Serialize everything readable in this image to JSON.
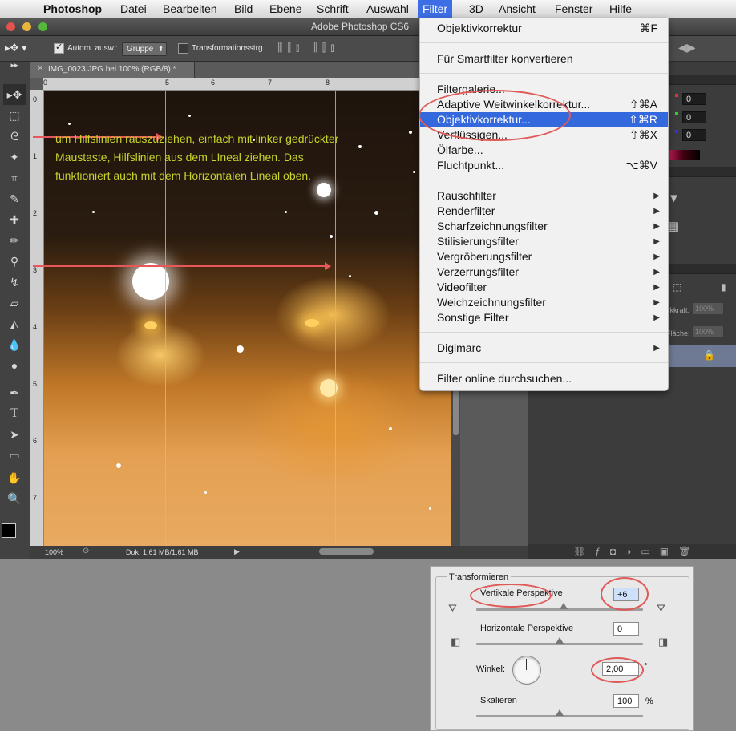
{
  "menubar": {
    "apple": "",
    "items": [
      "Photoshop",
      "Datei",
      "Bearbeiten",
      "Bild",
      "Ebene",
      "Schrift",
      "Auswahl",
      "Filter",
      "3D",
      "Ansicht",
      "Fenster",
      "Hilfe"
    ]
  },
  "window": {
    "title": "Adobe Photoshop CS6"
  },
  "options": {
    "auto_select_label": "Autom. ausw.:",
    "auto_select_value": "Gruppe",
    "transform_controls_label": "Transformationsstrg."
  },
  "document": {
    "tab_title": "IMG_0023.JPG bei 100% (RGB/8) *",
    "ruler_h": [
      "0",
      "5",
      "6",
      "7",
      "8"
    ],
    "ruler_v": [
      "0",
      "1",
      "2",
      "3",
      "4",
      "5",
      "6",
      "7"
    ],
    "annotation": "um Hilfslinien rauszuziehen, einfach mit linker gedrückter Maustaste, Hilfslinien aus dem LIneal ziehen. Das funktioniert auch mit dem Horizontalen Lineal oben.",
    "zoom": "100%",
    "doc_size": "Dok: 1,61 MB/1,61 MB"
  },
  "panels": {
    "color_values": [
      "0",
      "0",
      "0"
    ],
    "layer_opacity_label": "ckkraft:",
    "layer_opacity_value": "100%",
    "layer_fill_label": "Fläche:",
    "layer_fill_value": "100%"
  },
  "filter_menu": {
    "top_item": {
      "label": "Objektivkorrektur",
      "shortcut": "⌘F"
    },
    "smart": "Für Smartfilter konvertieren",
    "group1": [
      {
        "label": "Filtergalerie...",
        "shortcut": ""
      },
      {
        "label": "Adaptive Weitwinkelkorrektur...",
        "shortcut": "⇧⌘A"
      },
      {
        "label": "Objektivkorrektur...",
        "shortcut": "⇧⌘R",
        "highlighted": true
      },
      {
        "label": "Verflüssigen...",
        "shortcut": "⇧⌘X"
      },
      {
        "label": "Ölfarbe...",
        "shortcut": ""
      },
      {
        "label": "Fluchtpunkt...",
        "shortcut": "⌥⌘V"
      }
    ],
    "submenus": [
      "Rauschfilter",
      "Renderfilter",
      "Scharfzeichnungsfilter",
      "Stilisierungsfilter",
      "Vergröberungsfilter",
      "Verzerrungsfilter",
      "Videofilter",
      "Weichzeichnungsfilter",
      "Sonstige Filter"
    ],
    "digimarc": "Digimarc",
    "online": "Filter online durchsuchen..."
  },
  "transform_dialog": {
    "group_title": "Transformieren",
    "vertical_label": "Vertikale Perspektive",
    "vertical_value": "+6",
    "horizontal_label": "Horizontale Perspektive",
    "horizontal_value": "0",
    "angle_label": "Winkel:",
    "angle_value": "2,00",
    "angle_unit": "°",
    "scale_label": "Skalieren",
    "scale_value": "100",
    "scale_unit": "%"
  },
  "colors": {
    "highlight": "#3469dd",
    "annotation_red": "#e05a58",
    "guide": "#5fe3e3"
  }
}
